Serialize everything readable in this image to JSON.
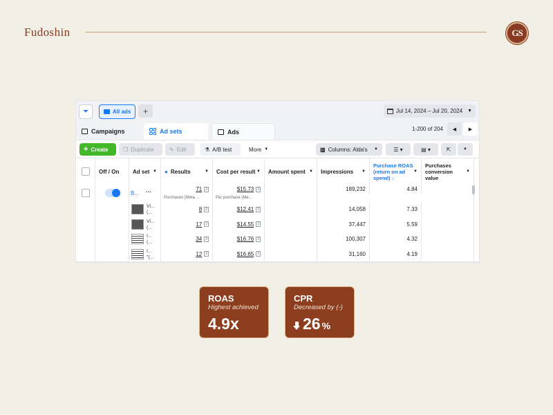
{
  "brand": {
    "name": "Fudoshin",
    "logo_text": "GS"
  },
  "screenshot": {
    "topbar": {
      "all_ads_label": "All ads",
      "add_label": "+",
      "date_range": "Jul 14, 2024 – Jul 20, 2024"
    },
    "tabs": [
      {
        "label": "Campaigns"
      },
      {
        "label": "Ad sets"
      },
      {
        "label": "Ads"
      }
    ],
    "pagination": {
      "text": "1-200 of 204"
    },
    "toolbar": {
      "create_label": "Create",
      "duplicate_label": "Duplicate",
      "edit_label": "Edit",
      "ab_test_label": "A/B test",
      "more_label": "More",
      "columns_label": "Columns: Alda's"
    },
    "columns": {
      "off_on": "Off / On",
      "ad_set": "Ad set",
      "results": "Results",
      "cost_per_result": "Cost per result",
      "amount_spent": "Amount spent",
      "impressions": "Impressions",
      "purchase_roas": "Purchase ROAS (return on ad spend) ↓",
      "purchases_conversion_value": "Purchases conversion value"
    },
    "summary_row": {
      "ad_set": "B...",
      "results": "71",
      "results_sub": "Purchases [Meta ...",
      "cost_per_result": "$15.73",
      "cost_sub": "Per purchase (Me...",
      "impressions": "189,232",
      "roas": "4.84"
    },
    "rows": [
      {
        "thumb_text_1": "Vi...",
        "thumb_text_2": "(...",
        "results": "8",
        "cost": "$12.41",
        "impressions": "14,058",
        "roas": "7.33"
      },
      {
        "thumb_text_1": "Vi...",
        "thumb_text_2": "(...",
        "results": "17",
        "cost": "$14.55",
        "impressions": "37,447",
        "roas": "5.59"
      },
      {
        "thumb_text_1": "I...",
        "thumb_text_2": "(...",
        "results": "34",
        "cost": "$16.76",
        "impressions": "100,307",
        "roas": "4.32"
      },
      {
        "thumb_text_1": "I...",
        "thumb_text_2": "\"(...",
        "results": "12",
        "cost": "$16.65",
        "impressions": "31,160",
        "roas": "4.19"
      }
    ]
  },
  "cards": [
    {
      "title": "ROAS",
      "subtitle": "Highest achieved",
      "value": "4.9x"
    },
    {
      "title": "CPR",
      "subtitle": "Decreased by (-)",
      "value": "26",
      "unit": "%"
    }
  ],
  "colors": {
    "brand": "#8a3a22",
    "card": "#8c3e1e",
    "accent": "#1877f2",
    "create": "#42b72a",
    "background": "#f2efe6"
  }
}
